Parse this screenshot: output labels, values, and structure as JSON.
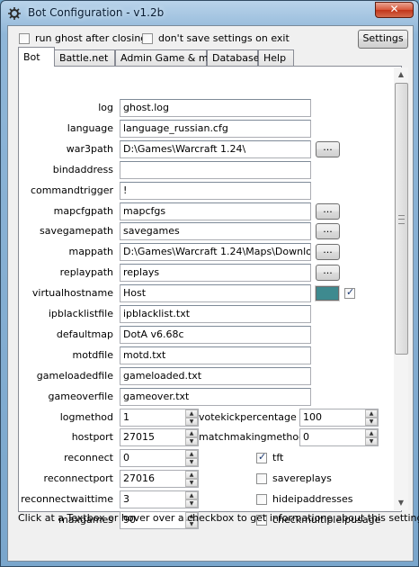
{
  "window": {
    "title": "Bot Configuration - v1.2b",
    "close_label": "✕"
  },
  "top": {
    "run_ghost_label": "run ghost after closing",
    "dont_save_label": "don't save settings on exit",
    "settings_label": "Settings"
  },
  "tabs": [
    {
      "label": "Bot",
      "active": true
    },
    {
      "label": "Battle.net"
    },
    {
      "label": "Admin Game & more"
    },
    {
      "label": "Database"
    },
    {
      "label": "Help"
    }
  ],
  "fields": [
    {
      "label": "log",
      "value": "ghost.log",
      "browse": false
    },
    {
      "label": "language",
      "value": "language_russian.cfg",
      "browse": false
    },
    {
      "label": "war3path",
      "value": "D:\\Games\\Warcraft 1.24\\",
      "browse": true
    },
    {
      "label": "bindaddress",
      "value": "",
      "browse": false
    },
    {
      "label": "commandtrigger",
      "value": "!",
      "browse": false
    },
    {
      "label": "mapcfgpath",
      "value": "mapcfgs",
      "browse": true
    },
    {
      "label": "savegamepath",
      "value": "savegames",
      "browse": true
    },
    {
      "label": "mappath",
      "value": "D:\\Games\\Warcraft 1.24\\Maps\\Download\\",
      "browse": true
    },
    {
      "label": "replaypath",
      "value": "replays",
      "browse": true
    },
    {
      "label": "virtualhostname",
      "value": "Host",
      "browse": false
    },
    {
      "label": "ipblacklistfile",
      "value": "ipblacklist.txt",
      "browse": false
    },
    {
      "label": "defaultmap",
      "value": "DotA v6.68c",
      "browse": false
    },
    {
      "label": "motdfile",
      "value": "motd.txt",
      "browse": false
    },
    {
      "label": "gameloadedfile",
      "value": "gameloaded.txt",
      "browse": false
    },
    {
      "label": "gameoverfile",
      "value": "gameover.txt",
      "browse": false
    }
  ],
  "browse_label": "...",
  "virtualhost_color": "#3e8a8f",
  "virtualhost_checked": true,
  "spinners_left": [
    {
      "label": "logmethod",
      "value": "1"
    },
    {
      "label": "hostport",
      "value": "27015"
    },
    {
      "label": "reconnect",
      "value": "0"
    },
    {
      "label": "reconnectport",
      "value": "27016"
    },
    {
      "label": "reconnectwaittime",
      "value": "3"
    },
    {
      "label": "maxgames",
      "value": "90"
    }
  ],
  "spinners_right": [
    {
      "label": "votekickpercentage",
      "value": "100"
    },
    {
      "label": "matchmakingmethod",
      "value": "0"
    }
  ],
  "checkboxes_right": [
    {
      "label": "tft",
      "checked": true
    },
    {
      "label": "savereplays",
      "checked": false
    },
    {
      "label": "hideipaddresses",
      "checked": false
    },
    {
      "label": "checkmultipleipusage",
      "checked": false
    }
  ],
  "status_text": "Click at a Textbox or hover over a checkbox to get informatione about this setting!"
}
